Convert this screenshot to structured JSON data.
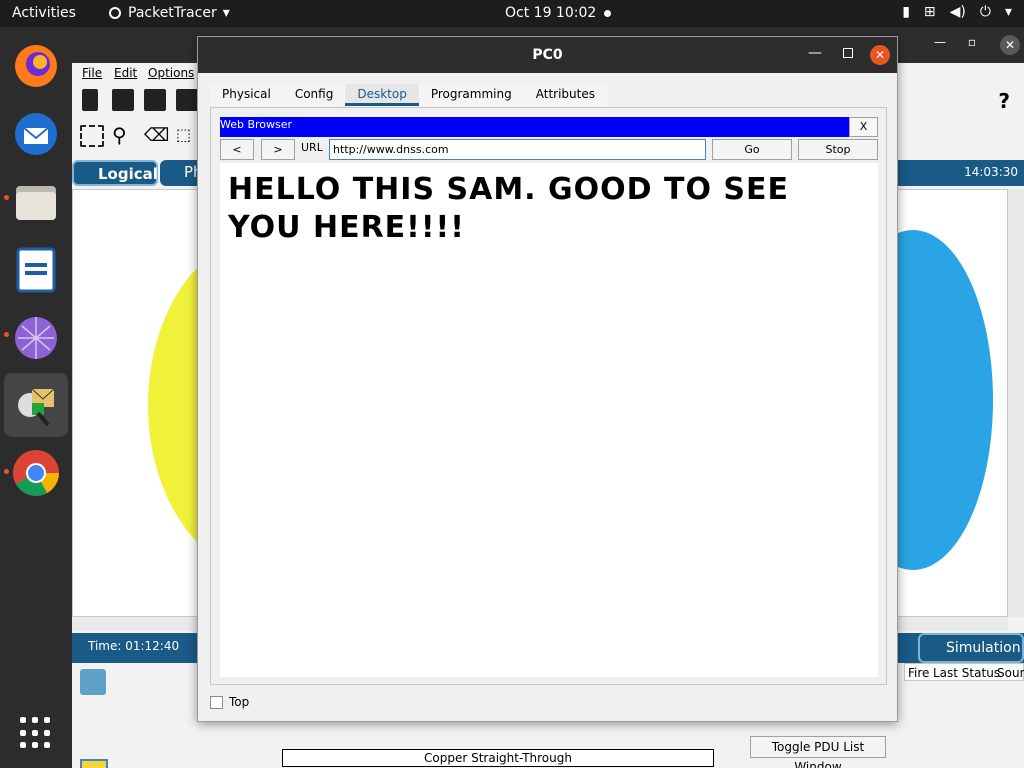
{
  "topbar": {
    "activities": "Activities",
    "app_name": "PacketTracer",
    "clock": "Oct 19  10:02"
  },
  "pt_main": {
    "menu": [
      "File",
      "Edit",
      "Options"
    ],
    "logical_tab": "Logical",
    "physical_tab": "Ph",
    "clock_right": "14:03:30",
    "time_label": "Time: 01:12:40",
    "simulation_button": "Simulation",
    "copper_label": "Copper Straight-Through",
    "toggle_pdu": "Toggle PDU List Window",
    "pdu_columns": [
      "Fire",
      "Last Status",
      "Sourc"
    ],
    "help": "?"
  },
  "dialog": {
    "title": "PC0",
    "tabs": [
      "Physical",
      "Config",
      "Desktop",
      "Programming",
      "Attributes"
    ],
    "active_tab": "Desktop",
    "browser": {
      "title": "Web Browser",
      "close": "X",
      "back": "<",
      "forward": ">",
      "url_label": "URL",
      "url_value": "http://www.dnss.com",
      "go": "Go",
      "stop": "Stop",
      "page_heading": "HELLO THIS SAM. GOOD TO SEE YOU HERE!!!!"
    },
    "top_checkbox": "Top"
  },
  "colors": {
    "browser_titlebar": "#0000ff",
    "ubuntu_orange": "#e95420",
    "pt_blue": "#1a5a86"
  }
}
